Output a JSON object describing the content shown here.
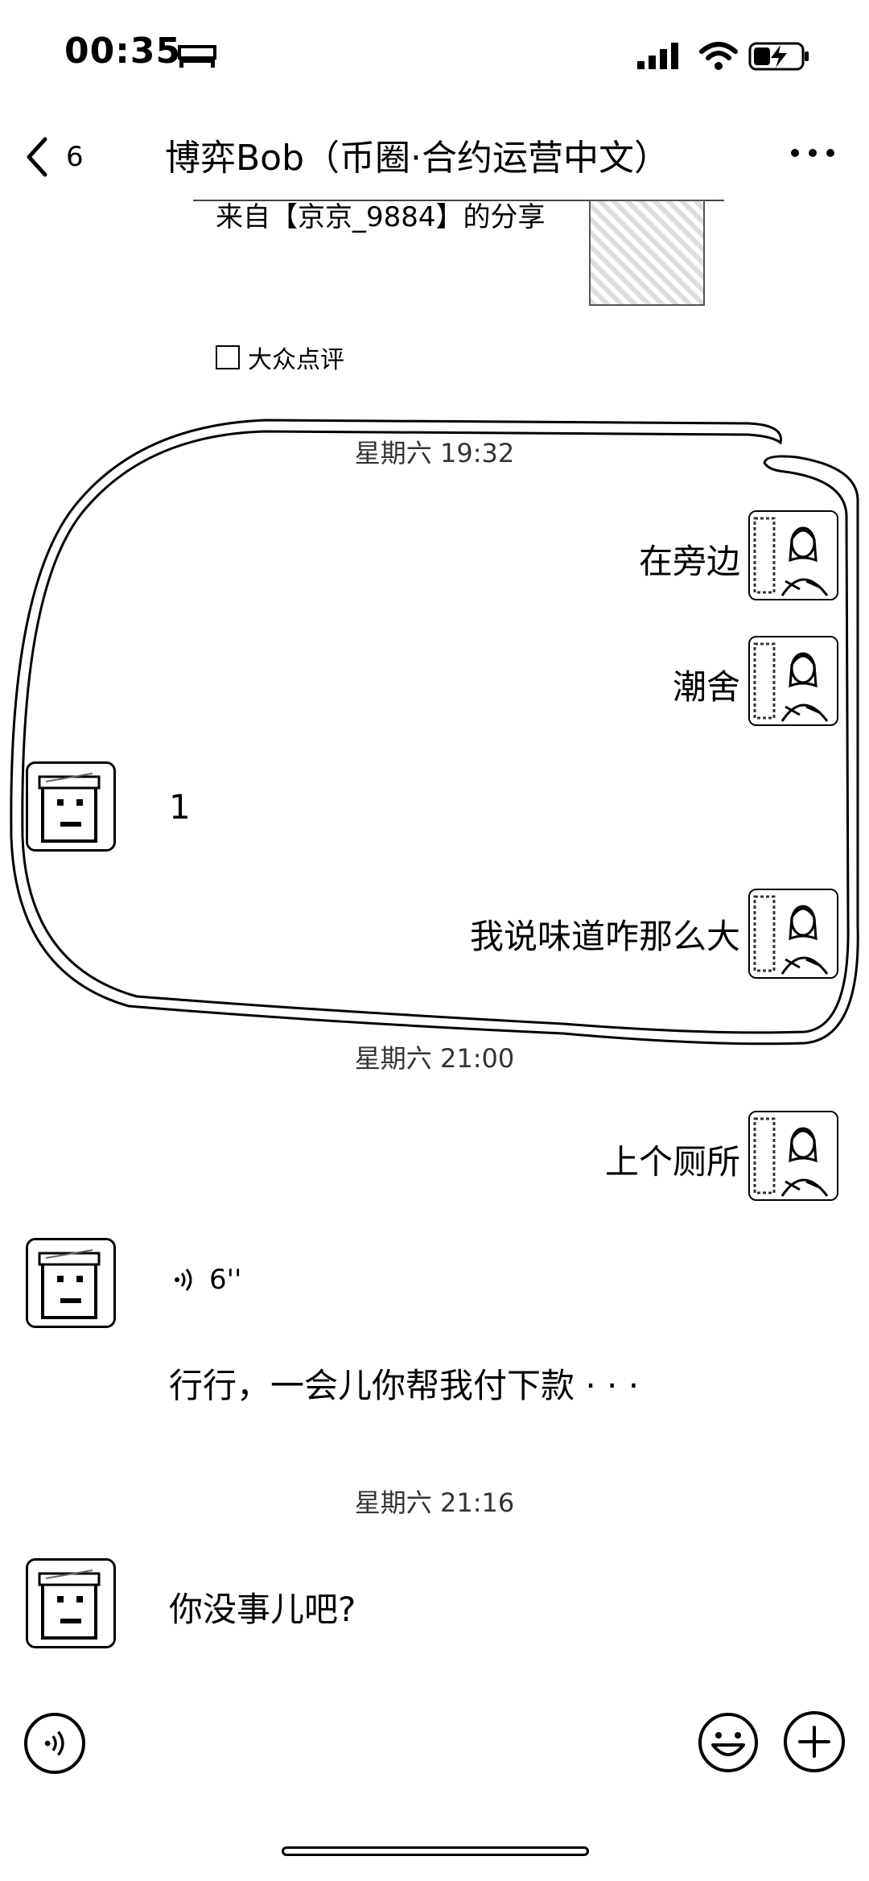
{
  "status_bar": {
    "time": "00:35",
    "icons": [
      "bed-icon",
      "signal-icon",
      "wifi-icon",
      "battery-charging-icon"
    ]
  },
  "header": {
    "back_count": "6",
    "title": "博弈Bob（币圈·合约运营中文）",
    "icons": [
      "back-chevron-icon",
      "more-icon"
    ]
  },
  "shared_card": {
    "text": "来自【京京_9884】的分享",
    "source": "大众点评"
  },
  "messages": [
    {
      "type": "time",
      "text": "星期六 19:32"
    },
    {
      "type": "text",
      "side": "right",
      "text": "在旁边"
    },
    {
      "type": "text",
      "side": "right",
      "text": "潮舍"
    },
    {
      "type": "text",
      "side": "left",
      "text": "1"
    },
    {
      "type": "text",
      "side": "right",
      "text": "我说味道咋那么大"
    },
    {
      "type": "time",
      "text": "星期六 21:00"
    },
    {
      "type": "text",
      "side": "right",
      "text": "上个厕所"
    },
    {
      "type": "voice",
      "side": "left",
      "duration": "6''"
    },
    {
      "type": "text",
      "side": "left",
      "text": "行行，一会儿你帮我付下款 · · ·"
    },
    {
      "type": "time",
      "text": "星期六 21:16"
    },
    {
      "type": "text",
      "side": "left",
      "text": "你没事儿吧?"
    }
  ],
  "input_bar": {
    "icons": [
      "voice-input-icon",
      "emoji-icon",
      "plus-icon"
    ]
  }
}
